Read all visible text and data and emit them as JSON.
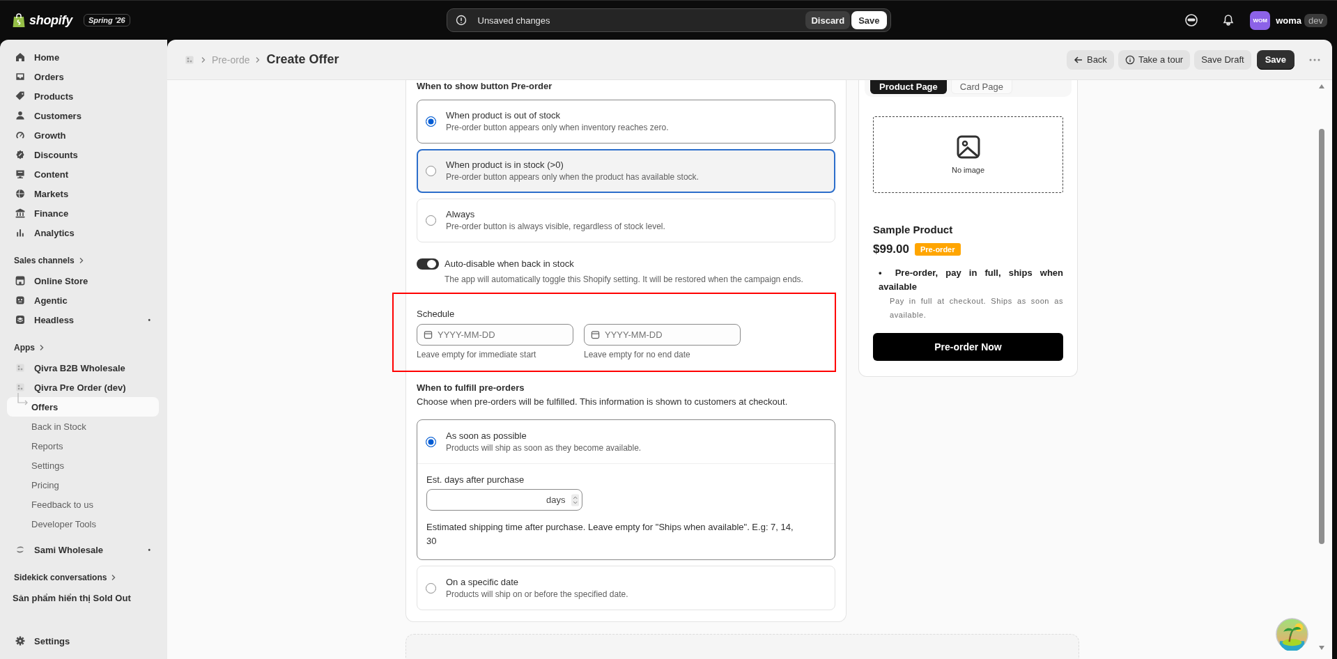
{
  "topbar": {
    "logo": "shopify",
    "edition": "Spring '26",
    "notice": "Unsaved changes",
    "discard": "Discard",
    "save": "Save",
    "avatar": "WOM",
    "store": "woma",
    "env": "dev"
  },
  "sidebar": {
    "sections": [
      {
        "items": [
          {
            "label": "Home",
            "selected": false
          },
          {
            "label": "Orders",
            "selected": false
          },
          {
            "label": "Products",
            "selected": false
          },
          {
            "label": "Customers",
            "selected": false
          },
          {
            "label": "Growth",
            "selected": false
          },
          {
            "label": "Discounts",
            "selected": false
          },
          {
            "label": "Content",
            "selected": false
          },
          {
            "label": "Markets",
            "selected": false
          },
          {
            "label": "Finance",
            "selected": false
          },
          {
            "label": "Analytics",
            "selected": false
          }
        ]
      },
      {
        "heading": "Sales channels",
        "items": [
          {
            "label": "Online Store",
            "selected": false
          },
          {
            "label": "Agentic",
            "selected": false
          },
          {
            "label": "Headless",
            "selected": false,
            "marker": "•"
          }
        ]
      },
      {
        "heading": "Apps",
        "items": [
          {
            "label": "Qivra B2B Wholesale",
            "selected": false
          },
          {
            "label": "Qivra Pre Order (dev)",
            "selected": false,
            "children": [
              {
                "label": "Offers",
                "selected": true
              },
              {
                "label": "Back in Stock",
                "selected": false
              },
              {
                "label": "Reports",
                "selected": false
              },
              {
                "label": "Settings",
                "selected": false
              },
              {
                "label": "Pricing",
                "selected": false
              },
              {
                "label": "Feedback to us",
                "selected": false
              },
              {
                "label": "Developer Tools",
                "selected": false
              }
            ]
          },
          {
            "label": "Sami Wholesale",
            "selected": false,
            "marker": "•"
          }
        ]
      },
      {
        "heading": "Sidekick conversations",
        "items": [
          {
            "label": "Sản phẩm hiển thị Sold Out",
            "selected": false
          }
        ]
      }
    ],
    "footer": "Settings"
  },
  "header": {
    "parent": "Pre-orde",
    "title": "Create Offer",
    "actions": [
      {
        "label": "Back",
        "kind": "back"
      },
      {
        "label": "Take a tour",
        "kind": "tour"
      },
      {
        "label": "Save Draft",
        "kind": "secondary"
      },
      {
        "label": "Save",
        "kind": "primary"
      }
    ]
  },
  "show_button": {
    "heading": "When to show button Pre-order",
    "options": [
      {
        "title": "When product is out of stock",
        "description": "Pre-order button appears only when inventory reaches zero.",
        "selected": true,
        "focused": false
      },
      {
        "title": "When product is in stock (>0)",
        "description": "Pre-order button appears only when the product has available stock.",
        "selected": false,
        "focused": true
      },
      {
        "title": "Always",
        "description": "Pre-order button is always visible, regardless of stock level.",
        "selected": false,
        "focused": false
      }
    ]
  },
  "auto_disable": {
    "label": "Auto-disable when back in stock",
    "description": "The app will automatically toggle this Shopify setting. It will be restored when the campaign ends.",
    "on": true
  },
  "schedule": {
    "label": "Schedule",
    "highlighted": true,
    "fields": [
      {
        "placeholder": "YYYY-MM-DD",
        "hint": "Leave empty for immediate start"
      },
      {
        "placeholder": "YYYY-MM-DD",
        "hint": "Leave empty for no end date"
      }
    ]
  },
  "fulfillment": {
    "heading": "When to fulfill pre-orders",
    "description": "Choose when pre-orders will be fulfilled. This information is shown to customers at checkout.",
    "options": [
      {
        "title": "As soon as possible",
        "description": "Products will ship as soon as they become available.",
        "selected": true,
        "details": {
          "label": "Est. days after purchase",
          "suffix": "days",
          "help": "Estimated shipping time after purchase. Leave empty for \"Ships when available\". E.g: 7, 14, 30"
        }
      },
      {
        "title": "On a specific date",
        "description": "Products will ship on or before the specified date.",
        "selected": false
      }
    ]
  },
  "preview": {
    "tabs": [
      {
        "label": "Product Page",
        "selected": true
      },
      {
        "label": "Card Page",
        "selected": false
      }
    ],
    "image_placeholder": "No image",
    "product_name": "Sample Product",
    "price": "$99.00",
    "badge": "Pre-order",
    "plan_bullet": "•",
    "plan_title": "Pre-order, pay in full, ships when available",
    "plan_note": "Pay in full at checkout. Ships as soon as available.",
    "button": "Pre-order Now"
  }
}
